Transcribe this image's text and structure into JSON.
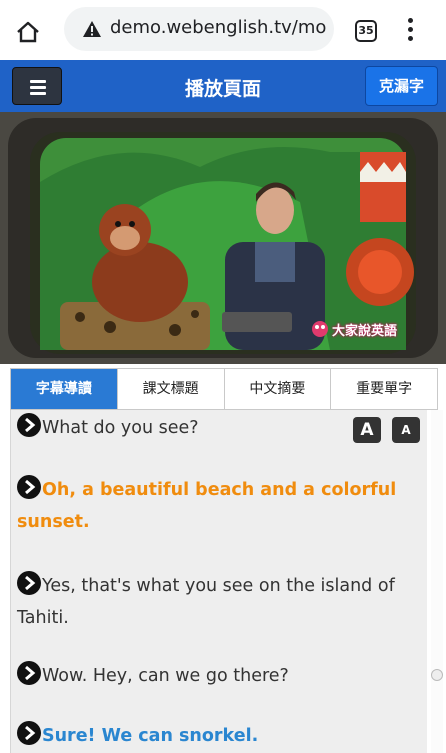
{
  "browser": {
    "url": "demo.webenglish.tv/mo",
    "tab_count": "35",
    "icons": {
      "home": "home-icon",
      "warning": "warning-icon",
      "menu": "more-vert-icon"
    }
  },
  "header": {
    "title": "播放頁面",
    "missing_words_label": "克漏字",
    "colors": {
      "bar": "#1f62c7",
      "button": "#1a73e8"
    }
  },
  "video": {
    "logo_text": "大家說英語"
  },
  "tabs": [
    {
      "label": "字幕導讀",
      "active": true
    },
    {
      "label": "課文標題",
      "active": false
    },
    {
      "label": "中文摘要",
      "active": false
    },
    {
      "label": "重要單字",
      "active": false
    }
  ],
  "font_size_controls": {
    "large": "A",
    "small": "A"
  },
  "subtitles": [
    {
      "text": "What do you see?",
      "style": "normal"
    },
    {
      "text": "Oh, a beautiful beach and a colorful sunset.",
      "style": "highlight"
    },
    {
      "text": "Yes, that's what you see on the island of Tahiti.",
      "style": "normal"
    },
    {
      "text": "Wow. Hey, can we go there?",
      "style": "normal"
    },
    {
      "text": "Sure! We can snorkel.",
      "style": "blue"
    }
  ],
  "colors": {
    "highlight": "#f08c0e",
    "blue_line": "#2a86d0",
    "active_tab": "#2a7ad4"
  }
}
